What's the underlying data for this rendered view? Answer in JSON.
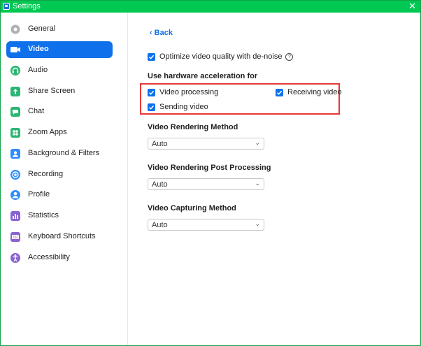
{
  "window": {
    "title": "Settings",
    "close_glyph": "✕"
  },
  "sidebar": {
    "items": [
      {
        "label": "General",
        "icon": "gear-icon",
        "color": "#b0b0b0",
        "active": false
      },
      {
        "label": "Video",
        "icon": "video-camera-icon",
        "color": "#0e71eb",
        "active": true
      },
      {
        "label": "Audio",
        "icon": "headphones-icon",
        "color": "#2bb673",
        "active": false
      },
      {
        "label": "Share Screen",
        "icon": "share-screen-icon",
        "color": "#2bb673",
        "active": false
      },
      {
        "label": "Chat",
        "icon": "chat-icon",
        "color": "#2bb673",
        "active": false
      },
      {
        "label": "Zoom Apps",
        "icon": "apps-icon",
        "color": "#2bb673",
        "active": false
      },
      {
        "label": "Background & Filters",
        "icon": "background-icon",
        "color": "#2d8cff",
        "active": false
      },
      {
        "label": "Recording",
        "icon": "record-icon",
        "color": "#2d8cff",
        "active": false
      },
      {
        "label": "Profile",
        "icon": "person-icon",
        "color": "#2d8cff",
        "active": false
      },
      {
        "label": "Statistics",
        "icon": "statistics-icon",
        "color": "#8a63d2",
        "active": false
      },
      {
        "label": "Keyboard Shortcuts",
        "icon": "keyboard-icon",
        "color": "#8a63d2",
        "active": false
      },
      {
        "label": "Accessibility",
        "icon": "accessibility-icon",
        "color": "#8a63d2",
        "active": false
      }
    ]
  },
  "main": {
    "back_label": "Back",
    "denoise": {
      "label": "Optimize video quality with de-noise",
      "checked": true
    },
    "hw_heading": "Use hardware acceleration for",
    "hw_options": {
      "video_processing": {
        "label": "Video processing",
        "checked": true
      },
      "receiving_video": {
        "label": "Receiving video",
        "checked": true
      },
      "sending_video": {
        "label": "Sending video",
        "checked": true
      }
    },
    "rendering_method": {
      "heading": "Video Rendering Method",
      "value": "Auto"
    },
    "post_processing": {
      "heading": "Video Rendering Post Processing",
      "value": "Auto"
    },
    "capturing_method": {
      "heading": "Video Capturing Method",
      "value": "Auto"
    }
  },
  "colors": {
    "accent": "#0e71eb",
    "titlebar": "#00c853",
    "highlight_box": "#e53935"
  }
}
